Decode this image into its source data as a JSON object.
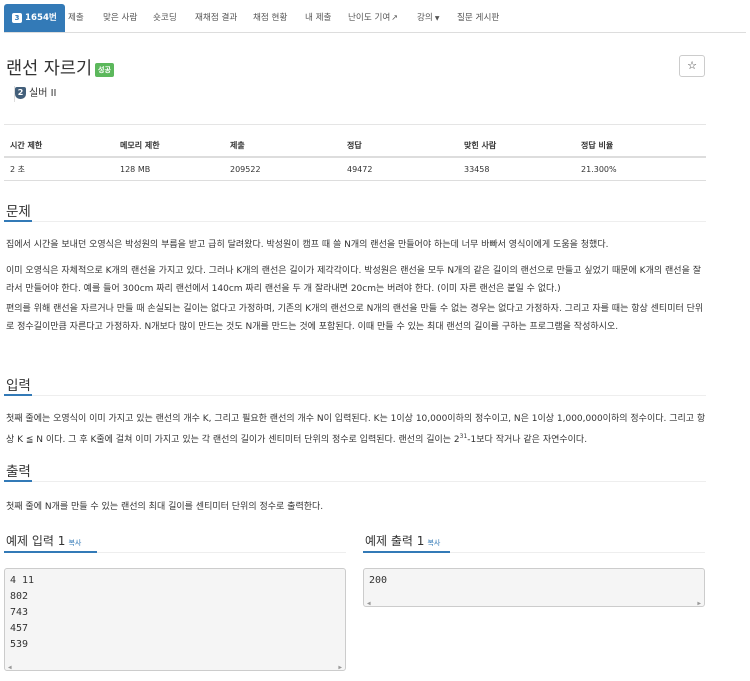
{
  "tabs": [
    {
      "label": "1654번",
      "badge": "3",
      "active": true
    },
    {
      "label": "제출"
    },
    {
      "label": "맞은 사람"
    },
    {
      "label": "숏코딩"
    },
    {
      "label": "재채점 결과"
    },
    {
      "label": "채점 현황"
    },
    {
      "label": "내 제출"
    },
    {
      "label": "난이도 기여"
    },
    {
      "label": "강의"
    },
    {
      "label": "질문 게시판"
    }
  ],
  "problem": {
    "title": "랜선 자르기",
    "status_badge": "성공",
    "tier_number": "2",
    "tier_label": "실버 II",
    "star": "☆"
  },
  "info_table": {
    "headers": [
      "시간 제한",
      "메모리 제한",
      "제출",
      "정답",
      "맞힌 사람",
      "정답 비율"
    ],
    "values": [
      "2 초",
      "128 MB",
      "209522",
      "49472",
      "33458",
      "21.300%"
    ]
  },
  "sections": {
    "description_title": "문제",
    "description_p1": "집에서 시간을 보내던 오영식은 박성원의 부름을 받고 급히 달려왔다. 박성원이 캠프 때 쓸 N개의 랜선을 만들어야 하는데 너무 바빠서 영식이에게 도움을 청했다.",
    "description_p2": "이미 오영식은 자체적으로 K개의 랜선을 가지고 있다. 그러나 K개의 랜선은 길이가 제각각이다. 박성원은 랜선을 모두 N개의 같은 길이의 랜선으로 만들고 싶었기 때문에 K개의 랜선을 잘라서 만들어야 한다. 예를 들어 300cm 짜리 랜선에서 140cm 짜리 랜선을 두 개 잘라내면 20cm는 버려야 한다. (이미 자른 랜선은 붙일 수 없다.)",
    "description_p3": "편의를 위해 랜선을 자르거나 만들 때 손실되는 길이는 없다고 가정하며, 기존의 K개의 랜선으로 N개의 랜선을 만들 수 없는 경우는 없다고 가정하자. 그리고 자를 때는 항상 센티미터 단위로 정수길이만큼 자른다고 가정하자. N개보다 많이 만드는 것도 N개를 만드는 것에 포함된다. 이때 만들 수 있는 최대 랜선의 길이를 구하는 프로그램을 작성하시오.",
    "input_title": "입력",
    "input_p1": "첫째 줄에는 오영식이 이미 가지고 있는 랜선의 개수 K, 그리고 필요한 랜선의 개수 N이 입력된다. K는 1이상 10,000이하의 정수이고, N은 1이상 1,000,000이하의 정수이다. 그리고 항상 K ≦ N 이다. 그 후 K줄에 걸쳐 이미 가지고 있는 각 랜선의 길이가 센티미터 단위의 정수로 입력된다. 랜선의 길이는 2",
    "input_sup": "31",
    "input_p1_tail": "-1보다 작거나 같은 자연수이다.",
    "output_title": "출력",
    "output_p1": "첫째 줄에 N개를 만들 수 있는 랜선의 최대 길이를 센티미터 단위의 정수로 출력한다."
  },
  "examples": {
    "input_title": "예제 입력 1",
    "output_title": "예제 출력 1",
    "copy_label": "복사",
    "input_lines": [
      "4 11",
      "802",
      "743",
      "457",
      "539"
    ],
    "output_lines": [
      "200"
    ]
  }
}
